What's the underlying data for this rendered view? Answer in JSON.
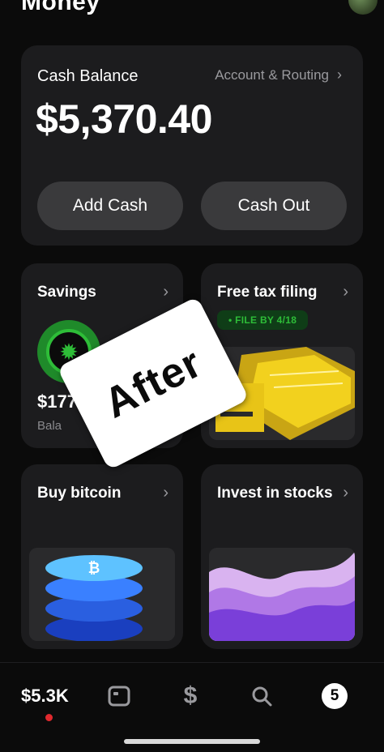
{
  "header": {
    "title": "Money"
  },
  "balance": {
    "label": "Cash Balance",
    "account_link": "Account & Routing",
    "amount": "$5,370.40",
    "add_cash": "Add Cash",
    "cash_out": "Cash Out"
  },
  "tiles": {
    "savings": {
      "title": "Savings",
      "amount": "$177",
      "sub": "Bala"
    },
    "tax": {
      "title": "Free tax filing",
      "badge": "• FILE BY 4/18"
    },
    "bitcoin": {
      "title": "Buy bitcoin"
    },
    "stocks": {
      "title": "Invest in stocks"
    }
  },
  "sticker": {
    "text": "After"
  },
  "nav": {
    "balance": "$5.3K",
    "notifications": "5",
    "icons": [
      "card-icon",
      "dollar-icon",
      "search-icon",
      "notification-icon"
    ]
  },
  "colors": {
    "accent": "#2ebd38",
    "card_bg": "#1c1c1e",
    "pill_bg": "#3a3a3c",
    "alert_dot": "#e0292e"
  }
}
